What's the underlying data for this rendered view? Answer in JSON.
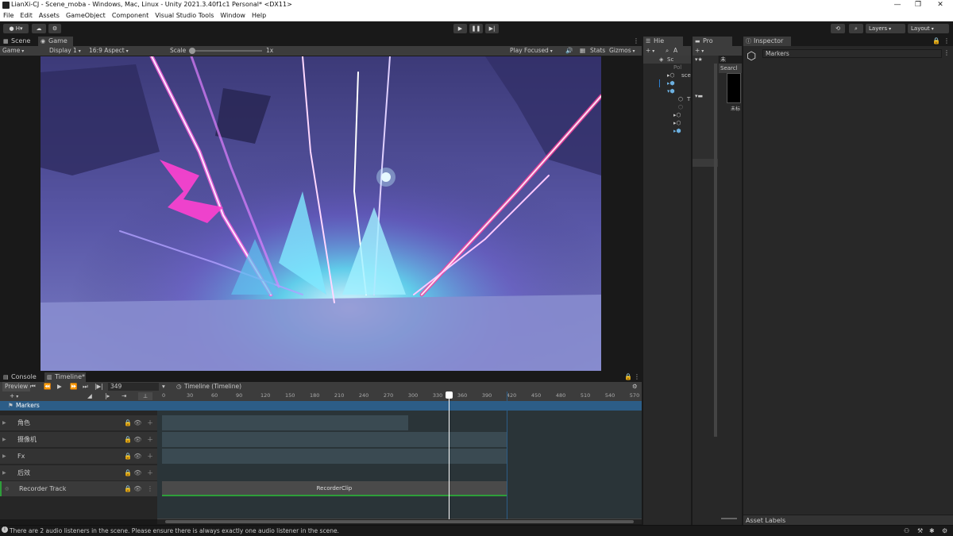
{
  "window": {
    "title": "LianXi-CJ - Scene_moba - Windows, Mac, Linux - Unity 2021.3.40f1c1 Personal* <DX11>",
    "minimize_glyph": "—",
    "maximize_glyph": "❐",
    "close_glyph": "✕"
  },
  "menu": [
    "File",
    "Edit",
    "Assets",
    "GameObject",
    "Component",
    "Visual Studio Tools",
    "Window",
    "Help"
  ],
  "toolbar": {
    "account_label": "H",
    "play_glyph": "▶",
    "pause_glyph": "❚❚",
    "step_glyph": "▶|",
    "layers_label": "Layers",
    "layout_label": "Layout"
  },
  "scene_tabs": {
    "scene": "Scene",
    "game": "Game"
  },
  "game_bar": {
    "mode": "Game",
    "display": "Display 1",
    "aspect": "16:9 Aspect",
    "scale_label": "Scale",
    "scale_value": "1x",
    "play_mode": "Play Focused",
    "stats": "Stats",
    "gizmos": "Gizmos"
  },
  "hierarchy": {
    "tab_label": "Hie",
    "search_glyph": "A",
    "scene_root": "Sc",
    "items": [
      "Pol",
      "sce",
      "",
      "",
      "T",
      "",
      "",
      "",
      "",
      ""
    ]
  },
  "project": {
    "tab_label": "Pro",
    "search_label": "Searcl",
    "search_input": "未",
    "thumb_label": "未标"
  },
  "inspector": {
    "tab_label": "Inspector",
    "object_name": "Markers",
    "asset_labels": "Asset Labels"
  },
  "bottom_tabs": {
    "console": "Console",
    "timeline": "Timeline*"
  },
  "timeline": {
    "preview_label": "Preview",
    "frame": "349",
    "asset_label": "Timeline (Timeline)",
    "playhead_frame": 349,
    "markers_label": "Markers",
    "ruler_ticks": [
      "0",
      "30",
      "60",
      "90",
      "120",
      "150",
      "180",
      "210",
      "240",
      "270",
      "300",
      "330",
      "360",
      "390",
      "420",
      "450",
      "480",
      "510",
      "540",
      "570"
    ],
    "tracks": [
      {
        "name": "角色",
        "clip_end_frame": 300
      },
      {
        "name": "摄像机",
        "clip_end_frame": 420
      },
      {
        "name": "Fx",
        "clip_end_frame": 420
      },
      {
        "name": "后效",
        "clip_end_frame": 0
      }
    ],
    "recorder": {
      "track_name": "Recorder Track",
      "clip_name": "RecorderClip",
      "clip_end_frame": 420
    }
  },
  "status": {
    "message": "There are 2 audio listeners in the scene. Please ensure there is always exactly one audio listener in the scene."
  },
  "colors": {
    "accent_blue": "#2c5d87",
    "recorder_green": "#2e9e3a",
    "panel": "#282828",
    "toolbar": "#3c3c3c"
  }
}
